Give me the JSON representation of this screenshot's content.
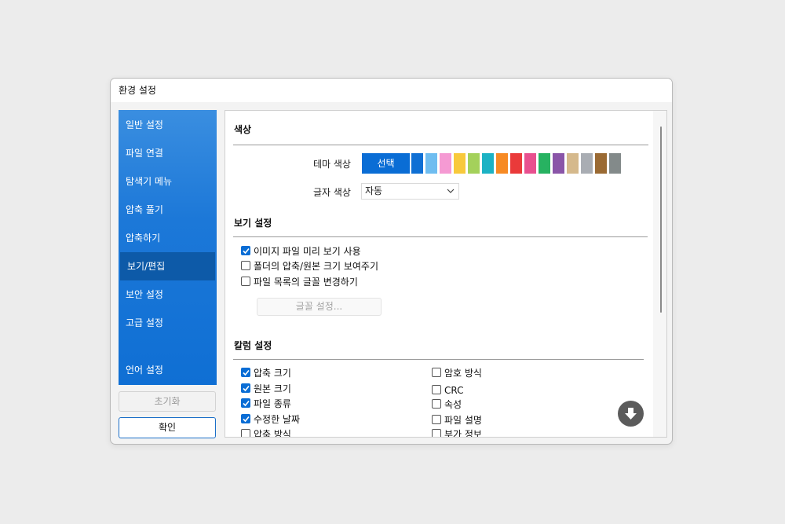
{
  "window": {
    "title": "환경 설정"
  },
  "sidebar": {
    "items": [
      {
        "label": "일반 설정"
      },
      {
        "label": "파일 연결"
      },
      {
        "label": "탐색기 메뉴"
      },
      {
        "label": "압축 풀기"
      },
      {
        "label": "압축하기"
      },
      {
        "label": "보기/편집"
      },
      {
        "label": "보안 설정"
      },
      {
        "label": "고급 설정"
      },
      {
        "label": "언어 설정"
      }
    ],
    "active_index": 5,
    "reset_label": "초기화",
    "ok_label": "확인"
  },
  "colors": {
    "section_title": "색상",
    "theme_label": "테마 색상",
    "theme_select_label": "선택",
    "swatches": [
      "#0f6fd4",
      "#6fbdf0",
      "#f59ad3",
      "#f8c93c",
      "#a4d15b",
      "#1cb2c4",
      "#f78a24",
      "#ea3a3a",
      "#e8508f",
      "#27b261",
      "#8a55a8",
      "#d5b98c",
      "#a9adb3",
      "#9a6a33",
      "#838a8a"
    ],
    "text_color_label": "글자 색상",
    "text_color_value": "자동"
  },
  "view": {
    "section_title": "보기 설정",
    "options": [
      {
        "label": "이미지 파일 미리 보기 사용",
        "checked": true
      },
      {
        "label": "폴더의 압축/원본 크기 보여주기",
        "checked": false
      },
      {
        "label": "파일 목록의 글꼴 변경하기",
        "checked": false
      }
    ],
    "font_button_label": "글꼴 설정..."
  },
  "columns": {
    "section_title": "칼럼 설정",
    "left": [
      {
        "label": "압축 크기",
        "checked": true
      },
      {
        "label": "원본 크기",
        "checked": true
      },
      {
        "label": "파일 종류",
        "checked": true
      },
      {
        "label": "수정한 날짜",
        "checked": true
      },
      {
        "label": "압축 방식",
        "checked": false
      }
    ],
    "right": [
      {
        "label": "암호 방식",
        "checked": false
      },
      {
        "label": "CRC",
        "checked": false
      },
      {
        "label": "속성",
        "checked": false
      },
      {
        "label": "파일 설명",
        "checked": false
      },
      {
        "label": "부가 정보",
        "checked": false
      }
    ]
  }
}
